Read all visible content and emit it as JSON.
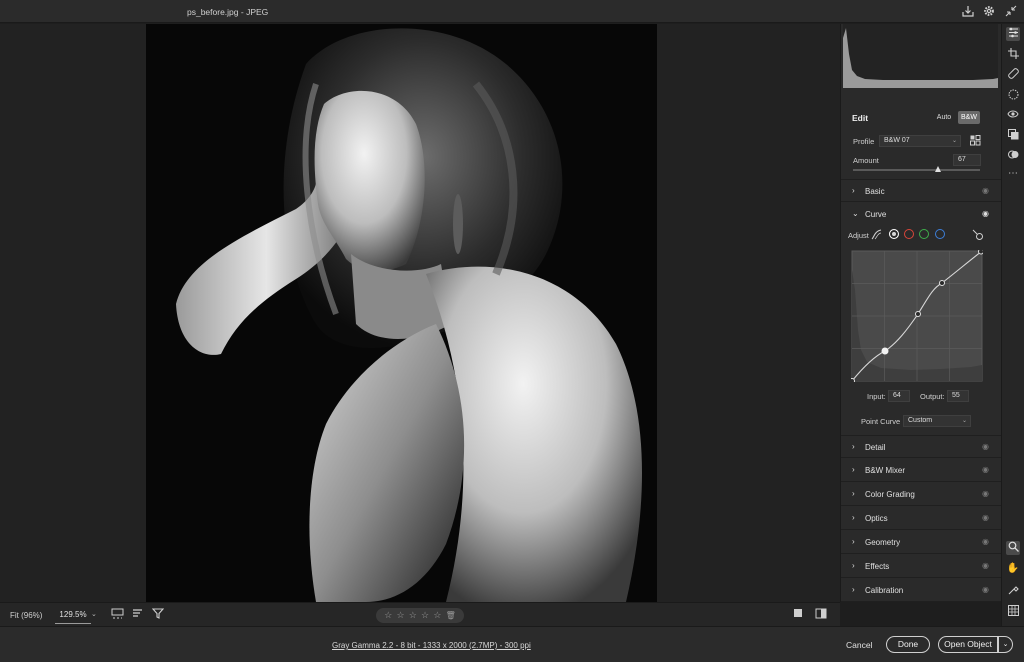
{
  "window": {
    "title": "ps_before.jpg  -  JPEG"
  },
  "icons": [
    "save-icon",
    "gear-icon",
    "collapse-icon"
  ],
  "bottom_bar": {
    "fit_label": "Fit (96%)",
    "zoom_value": "129.5%",
    "rating_stars": [
      "☆",
      "☆",
      "☆",
      "☆",
      "☆"
    ]
  },
  "footer": {
    "image_info": "Gray Gamma 2.2 - 8 bit - 1333 x 2000 (2.7MP) - 300 ppi",
    "cancel_label": "Cancel",
    "done_label": "Done",
    "open_label": "Open Object"
  },
  "edit_panel": {
    "title": "Edit",
    "auto_label": "Auto",
    "bw_label": "B&W",
    "profile_label": "Profile",
    "profile_value": "B&W 07",
    "amount_label": "Amount",
    "amount_value": "67",
    "amount_level": 0.67
  },
  "sections": {
    "basic": "Basic",
    "curve": "Curve",
    "detail": "Detail",
    "bw_mixer": "B&W Mixer",
    "color_grading": "Color Grading",
    "optics": "Optics",
    "geometry": "Geometry",
    "effects": "Effects",
    "calibration": "Calibration"
  },
  "curve": {
    "adjust_label": "Adjust",
    "input_label": "Input:",
    "input_value": "64",
    "output_label": "Output:",
    "output_value": "55",
    "point_curve_label": "Point Curve",
    "point_curve_value": "Custom",
    "channel_colors": [
      "#d8d8d8",
      "#d9453a",
      "#3fae4b",
      "#3d7fd9"
    ]
  }
}
